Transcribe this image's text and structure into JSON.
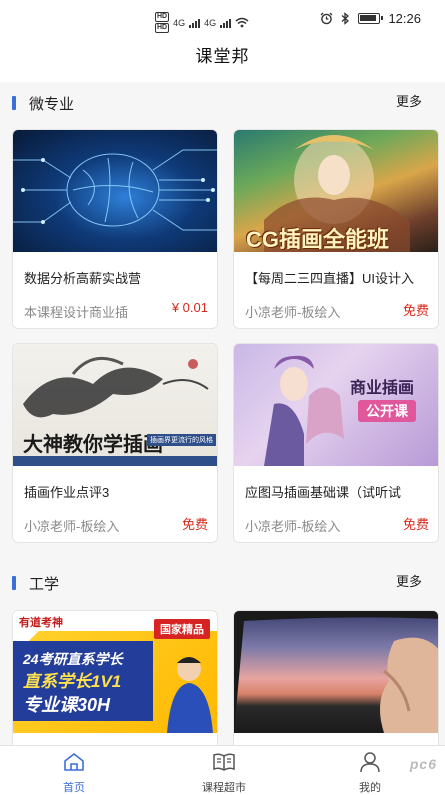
{
  "status": {
    "time": "12:26",
    "net1": "4G",
    "net2": "4G"
  },
  "header": {
    "title": "课堂邦"
  },
  "sections": [
    {
      "title": "微专业",
      "more": "更多",
      "cards": [
        {
          "title": "数据分析高薪实战营",
          "teacher": "本课程设计商业插",
          "price": "¥ 0.01",
          "image": "brain-network-banner"
        },
        {
          "title": "【每周二三四直播】UI设计入",
          "teacher": "小凉老师-板绘入",
          "price": "免费",
          "image": "cg-illustration-banner",
          "image_text": "CG插画全能班"
        },
        {
          "title": "插画作业点评3",
          "teacher": "小凉老师-板绘入",
          "price": "免费",
          "image": "ink-painting-banner",
          "image_text": "大神教你学插画",
          "image_subtext": "插画界更流行的风格"
        },
        {
          "title": "应图马插画基础课（试听试",
          "teacher": "小凉老师-板绘入",
          "price": "免费",
          "image": "commercial-illustration-banner",
          "image_text": "商业插画",
          "image_subtext": "公开课"
        }
      ]
    },
    {
      "title": "工学",
      "more": "更多",
      "cards": [
        {
          "image": "kaoyan-banner",
          "badge": "国家精品",
          "brand": "有道考神",
          "line1": "24考研直系学长",
          "line2": "直系学长1V1",
          "line3": "专业课30H"
        },
        {
          "image": "sunset-window-photo"
        }
      ]
    }
  ],
  "tabs": [
    {
      "label": "首页",
      "icon": "home-icon",
      "active": true
    },
    {
      "label": "课程超市",
      "icon": "book-icon",
      "active": false
    },
    {
      "label": "我的",
      "icon": "user-icon",
      "active": false
    }
  ],
  "watermark": "pc6",
  "colors": {
    "accent": "#3b6fd8",
    "price": "#d8281d",
    "tab_active": "#3b6fd8"
  }
}
